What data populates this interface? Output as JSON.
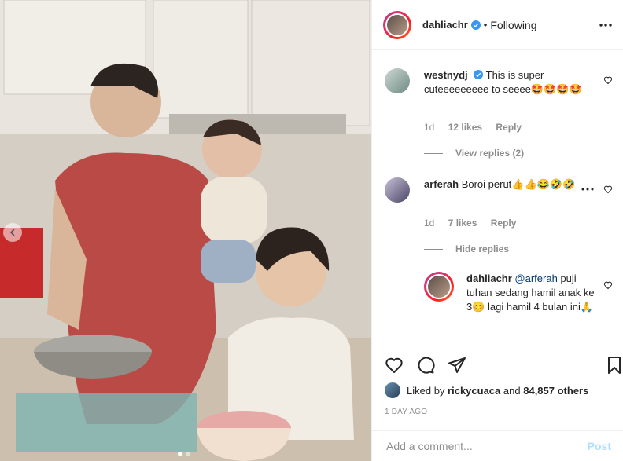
{
  "post": {
    "author": "dahliachr",
    "follow_status": "Following",
    "separator": "•"
  },
  "comments": [
    {
      "user": "westnydj",
      "text": "This is super cuteeeeeeeee to seeee",
      "emoji": "🤩🤩🤩🤩",
      "time": "1d",
      "likes": "12 likes",
      "reply_label": "Reply",
      "thread_toggle": "View replies (2)"
    },
    {
      "user": "arferah",
      "text": "Boroi perut",
      "emoji": "👍👍😂🤣🤣",
      "time": "1d",
      "likes": "7 likes",
      "reply_label": "Reply",
      "thread_toggle": "Hide replies"
    }
  ],
  "reply": {
    "user": "dahliachr",
    "mention": "@arferah",
    "text_1": "puji tuhan sedang hamil anak ke 3",
    "emoji_1": "😊",
    "text_2": "lagi hamil 4 bulan ini",
    "emoji_2": "🙏"
  },
  "likes_line": {
    "prefix": "Liked by",
    "user": "rickycuaca",
    "connector": "and",
    "others": "84,857 others"
  },
  "timestamp": "1 DAY AGO",
  "composer": {
    "placeholder": "Add a comment...",
    "post_label": "Post",
    "post_color": "#b2dffc"
  },
  "icons": [
    "three-dots-icon",
    "heart-icon",
    "comment-icon",
    "share-icon",
    "bookmark-icon",
    "verified-badge-icon",
    "chevron-left-icon"
  ],
  "colors": {
    "verified": "#3897f0",
    "muted": "#8e8e8e",
    "text": "#262626",
    "border": "#efefef"
  }
}
